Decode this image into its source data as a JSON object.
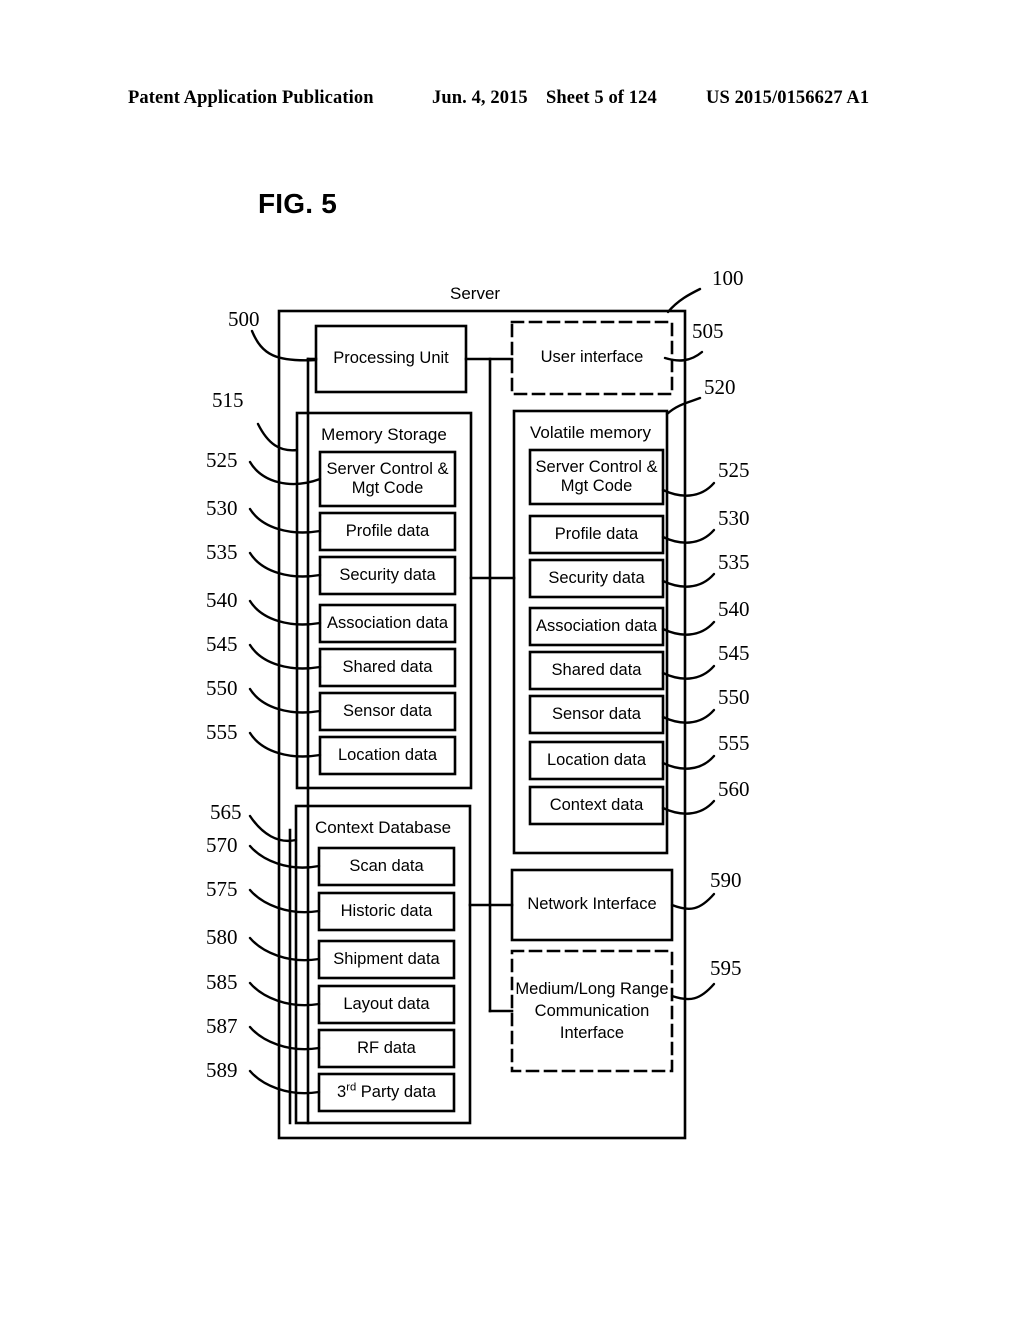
{
  "header": {
    "publication": "Patent Application Publication",
    "date": "Jun. 4, 2015",
    "sheet": "Sheet 5 of 124",
    "patent_number": "US 2015/0156627 A1"
  },
  "figure": {
    "title": "FIG. 5",
    "system_label": "Server",
    "system_ref": "100"
  },
  "blocks": {
    "processing_unit": {
      "label": "Processing Unit",
      "ref": "500"
    },
    "user_interface": {
      "label": "User interface",
      "ref": "505",
      "dashed": true
    },
    "memory_storage": {
      "label": "Memory Storage",
      "ref": "515"
    },
    "volatile_memory": {
      "label": "Volatile memory",
      "ref": "520"
    },
    "context_database": {
      "label": "Context Database",
      "ref": "565"
    },
    "network_interface": {
      "label": "Network Interface",
      "ref": "590"
    },
    "comm_interface": {
      "label": "Medium/Long Range\nCommunication\nInterface",
      "ref": "595",
      "dashed": true
    }
  },
  "memory_storage_items": [
    {
      "label": "Server Control &\nMgt Code",
      "ref": "525",
      "tall": true
    },
    {
      "label": "Profile data",
      "ref": "530"
    },
    {
      "label": "Security data",
      "ref": "535"
    },
    {
      "label": "Association data",
      "ref": "540"
    },
    {
      "label": "Shared data",
      "ref": "545"
    },
    {
      "label": "Sensor data",
      "ref": "550"
    },
    {
      "label": "Location data",
      "ref": "555"
    }
  ],
  "volatile_memory_items": [
    {
      "label": "Server Control &\nMgt Code",
      "ref": "525",
      "tall": true
    },
    {
      "label": "Profile data",
      "ref": "530"
    },
    {
      "label": "Security data",
      "ref": "535"
    },
    {
      "label": "Association data",
      "ref": "540"
    },
    {
      "label": "Shared data",
      "ref": "545"
    },
    {
      "label": "Sensor data",
      "ref": "550"
    },
    {
      "label": "Location data",
      "ref": "555"
    },
    {
      "label": "Context data",
      "ref": "560"
    }
  ],
  "context_database_items": [
    {
      "label": "Scan data",
      "ref": "570"
    },
    {
      "label": "Historic data",
      "ref": "575"
    },
    {
      "label": "Shipment data",
      "ref": "580"
    },
    {
      "label": "Layout data",
      "ref": "585"
    },
    {
      "label": "RF data",
      "ref": "587"
    },
    {
      "label": "3rd Party data",
      "ref": "589",
      "html": "3<sup>rd</sup> Party data"
    }
  ],
  "colors": {
    "ink": "#000000",
    "paper": "#ffffff"
  }
}
